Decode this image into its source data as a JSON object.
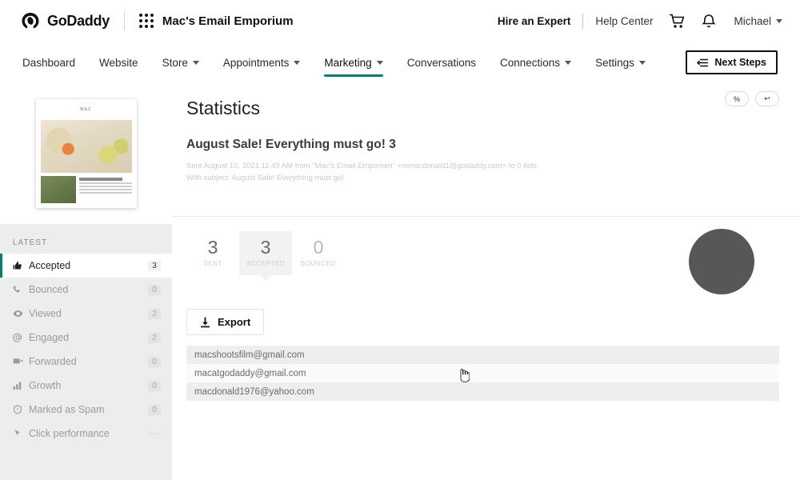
{
  "header": {
    "brand_name": "GoDaddy",
    "logo_icon": "godaddy-heart-logo",
    "apps_icon": "apps-grid-icon",
    "venture_name": "Mac's Email Emporium",
    "hire_expert": "Hire an Expert",
    "help_center": "Help Center",
    "cart_icon": "shopping-cart-icon",
    "bell_icon": "notification-bell-icon",
    "user_name": "Michael",
    "user_caret_icon": "chevron-down-icon"
  },
  "nav": {
    "items": [
      {
        "label": "Dashboard",
        "has_caret": false,
        "active": false
      },
      {
        "label": "Website",
        "has_caret": false,
        "active": false
      },
      {
        "label": "Store",
        "has_caret": true,
        "active": false
      },
      {
        "label": "Appointments",
        "has_caret": true,
        "active": false
      },
      {
        "label": "Marketing",
        "has_caret": true,
        "active": true
      },
      {
        "label": "Conversations",
        "has_caret": false,
        "active": false
      },
      {
        "label": "Connections",
        "has_caret": true,
        "active": false
      },
      {
        "label": "Settings",
        "has_caret": true,
        "active": false
      }
    ],
    "next_steps_label": "Next Steps",
    "next_steps_icon": "next-steps-list-icon",
    "active_underline_color": "#0a7c72"
  },
  "sidebar": {
    "section_label": "LATEST",
    "thumbnail_alt": "email-preview-thumbnail",
    "items": [
      {
        "label": "Accepted",
        "count": "3",
        "icon": "thumbs-up-icon",
        "active": true
      },
      {
        "label": "Bounced",
        "count": "0",
        "icon": "phone-bounce-icon",
        "active": false
      },
      {
        "label": "Viewed",
        "count": "2",
        "icon": "eye-icon",
        "active": false
      },
      {
        "label": "Engaged",
        "count": "2",
        "icon": "at-sign-icon",
        "active": false
      },
      {
        "label": "Forwarded",
        "count": "0",
        "icon": "forward-icon",
        "active": false
      },
      {
        "label": "Growth",
        "count": "0",
        "icon": "bar-chart-icon",
        "active": false
      },
      {
        "label": "Marked as Spam",
        "count": "0",
        "icon": "spam-shield-icon",
        "active": false
      },
      {
        "label": "Click performance",
        "count": "",
        "icon": "cursor-click-icon",
        "active": false
      }
    ]
  },
  "main": {
    "page_title": "Statistics",
    "campaign_title": "August Sale! Everything must go! 3",
    "sent_description_line1": "Sent August 10, 2021 11:49 AM from \"Mac's Email Emporium\" <mmacdonald1@godaddy.com> to 0 lists.",
    "sent_description_line2": "With subject: August Sale! Everything must go!",
    "head_actions": [
      {
        "icon": "percent-icon",
        "glyph": "%"
      },
      {
        "icon": "undo-arrow-icon",
        "glyph": "↩"
      }
    ],
    "stats": [
      {
        "label": "SENT",
        "value": "3",
        "hovered": false,
        "muted": false
      },
      {
        "label": "ACCEPTED",
        "value": "3",
        "hovered": true,
        "muted": false
      },
      {
        "label": "BOUNCED",
        "value": "0",
        "hovered": false,
        "muted": true
      }
    ],
    "donut": {
      "name": "accepted-donut-chart",
      "color": "#575757",
      "percent": 100
    },
    "export_label": "Export",
    "export_icon": "download-icon",
    "emails": [
      "macshootsfilm@gmail.com",
      "macatgodaddy@gmail.com",
      "macdonald1976@yahoo.com"
    ],
    "cursor_icon": "pointer-hand-cursor"
  },
  "chart_data": {
    "type": "pie",
    "title": "Accepted",
    "categories": [
      "Accepted",
      "Bounced"
    ],
    "values": [
      3,
      0
    ],
    "colors": [
      "#575757",
      "#eeeeee"
    ],
    "legend": "none"
  }
}
